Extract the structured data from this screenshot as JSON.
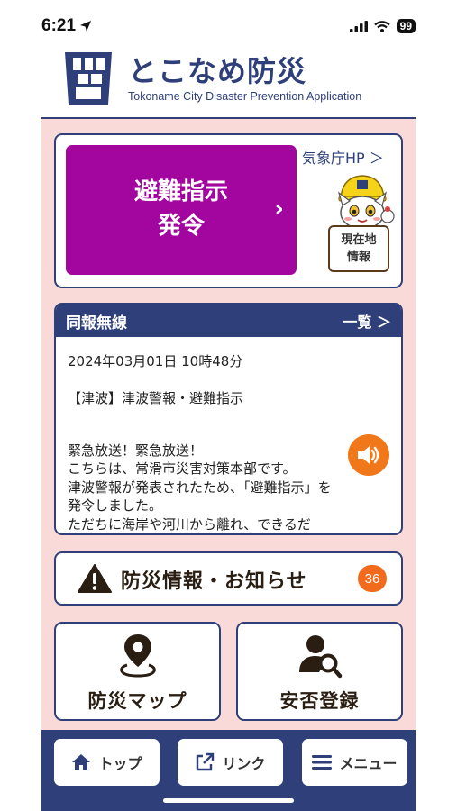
{
  "status_bar": {
    "time": "6:21",
    "battery": "99",
    "icons": [
      "location-arrow-icon",
      "cellular-signal-icon",
      "wifi-icon",
      "battery-icon"
    ]
  },
  "header": {
    "title": "とこなめ防災",
    "subtitle": "Tokoname City Disaster Prevention Application",
    "logo": "tokoname-logo-icon"
  },
  "evacuation": {
    "line1": "避難指示",
    "line2": "発令",
    "chevron": "›",
    "color": "#a3069e"
  },
  "jma_link": {
    "label": "気象庁HP ＞"
  },
  "location_button": {
    "line1": "現在地",
    "line2": "情報"
  },
  "broadcast": {
    "title": "同報無線",
    "list_link": "一覧 ＞",
    "datetime": "2024年03月01日 10時48分",
    "subject": "【津波】津波警報・避難指示",
    "message": "緊急放送！緊急放送！\nこちらは、常滑市災害対策本部です。\n津波警報が発表されたため、「避難指示」を発令しました。\nただちに海岸や河川から離れ、できるだ"
  },
  "info": {
    "label": "防災情報・お知らせ",
    "count": "36",
    "badge_color": "#f26a1b"
  },
  "tiles": {
    "map_label": "防災マップ",
    "safety_label": "安否登録"
  },
  "bottom_nav": {
    "top_label": "トップ",
    "link_label": "リンク",
    "menu_label": "メニュー"
  },
  "colors": {
    "navy": "#2f3f7a",
    "pink_background": "#fad9d9",
    "orange": "#f0781a"
  }
}
